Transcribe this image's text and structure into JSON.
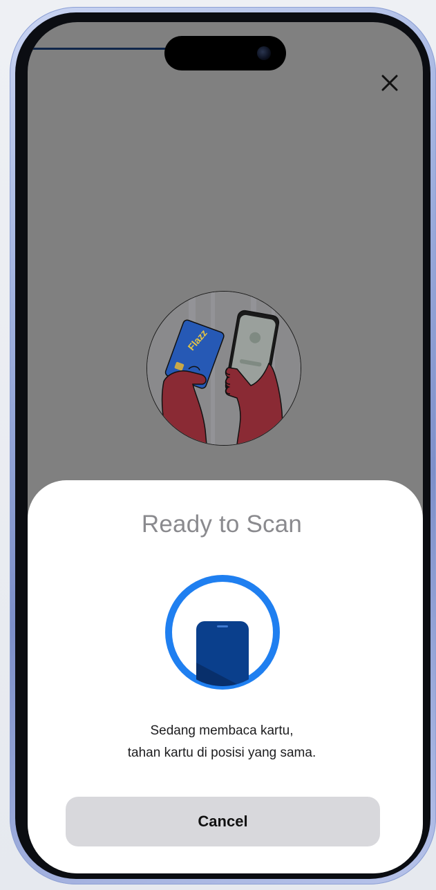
{
  "screen": {
    "close_icon": "close-icon",
    "illustration": "hands-holding-card-and-phone-illustration"
  },
  "nfc_sheet": {
    "title": "Ready to Scan",
    "message_line1": "Sedang membaca kartu,",
    "message_line2": "tahan kartu di posisi yang sama.",
    "cancel_label": "Cancel",
    "scan_icon": "phone-scan-icon",
    "accent_color": "#1f7ff0"
  },
  "card": {
    "brand_text": "Flazz",
    "color": "#2659b5"
  }
}
